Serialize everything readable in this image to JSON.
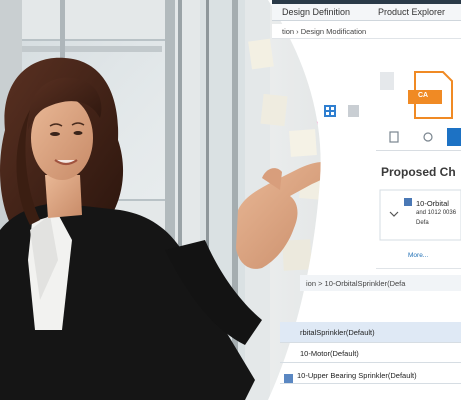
{
  "ui": {
    "tabs": [
      "Design Definition",
      "Product Explorer"
    ],
    "breadcrumb": "tion › Design Modification",
    "doc_badge": "CA",
    "section_title": "Proposed Ch",
    "item_title": "10-Orbital",
    "item_sub": "and 1012 0036",
    "item_sub2": "Defa",
    "more_link": "More...",
    "footer_path": "ion > 10-OrbitalSprinkler(Defa",
    "rows": [
      "rbitalSprinkler(Default)",
      "10-Motor(Default)",
      "10-Upper Bearing Sprinkler(Default)"
    ]
  },
  "colors": {
    "accent_orange": "#f08a24",
    "accent_blue": "#1d72c4",
    "header_bar": "#e9eef3",
    "row_highlight": "#dfe9f5"
  }
}
